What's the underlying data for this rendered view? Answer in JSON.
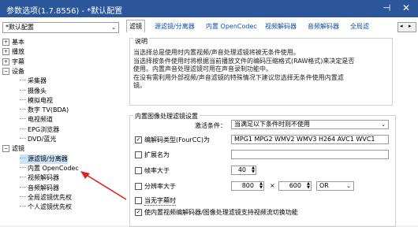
{
  "window": {
    "title": "参数选项(1.7.8556) - *默认配置",
    "pin_glyph": "⊣",
    "close_glyph": "✕"
  },
  "profile": {
    "value": "*默认配置"
  },
  "tree": [
    {
      "label": "基本",
      "level": 0,
      "exp": "+"
    },
    {
      "label": "播放",
      "level": 0,
      "exp": "+"
    },
    {
      "label": "字幕",
      "level": 0,
      "exp": "+"
    },
    {
      "label": "设备",
      "level": 0,
      "exp": "−"
    },
    {
      "label": "采集器",
      "level": 1
    },
    {
      "label": "摄像头",
      "level": 1
    },
    {
      "label": "模拟电视",
      "level": 1
    },
    {
      "label": "数字 TV(BDA)",
      "level": 1
    },
    {
      "label": "电视频道",
      "level": 1
    },
    {
      "label": "EPG浏览器",
      "level": 1
    },
    {
      "label": "DVD/蓝光",
      "level": 1
    },
    {
      "label": "滤镜",
      "level": 0,
      "exp": "−"
    },
    {
      "label": "源滤镜/分离器",
      "level": 1
    },
    {
      "label": "内置 OpenCodec",
      "level": 1
    },
    {
      "label": "视频解码器",
      "level": 1
    },
    {
      "label": "音频解码器",
      "level": 1
    },
    {
      "label": "全局滤镜优先权",
      "level": 1
    },
    {
      "label": "个人滤镜优先权",
      "level": 1
    }
  ],
  "tabs": [
    "滤镜",
    "源滤镜/分离器",
    "内置 OpenCodec",
    "视频解码器",
    "音频解码器",
    "全局滤"
  ],
  "tab_scroll": {
    "left": "◂",
    "right": "▸"
  },
  "desc_group": {
    "title": "说明",
    "lines": [
      "当选择总是使用时内置视频/声音处理滤镜将被无条件使用。",
      "当选择按条件使用时将根据当前播放文件的编码压缩格式(RAW格式)来决定是否",
      "使用。内置声音处理滤镜可用在声音录制功能中。",
      "在没有需利用外部视频/声音滤镜的特殊情况下建议您选择无条件使用内置滤",
      "镜。"
    ]
  },
  "filter_group": {
    "title": "内置图像处理滤镜设置",
    "activation_label": "激活条件：",
    "activation_value": "当满足以下条件时则不使用",
    "codec_label": "编解码类型(FourCC)为",
    "codec_value": "MPG1 MPG2 WMV2 WMV3 H264 AVC1 WVC1",
    "ext_label": "扩展名为",
    "ext_value": "",
    "fps_label": "帧率大于",
    "fps_value": "40",
    "res_label": "分辨率大于",
    "res_w": "800",
    "res_x": "×",
    "res_h": "600",
    "res_op": "OR",
    "silent_label": "当无字幕时",
    "linked_label": "使内置视频编解码器/图像处理滤镜支持视频流切换功能"
  },
  "colors": {
    "titlebar": "#2b579a",
    "link": "#0b4fa8",
    "selection": "#cce4f7",
    "arrow": "#e02020"
  }
}
